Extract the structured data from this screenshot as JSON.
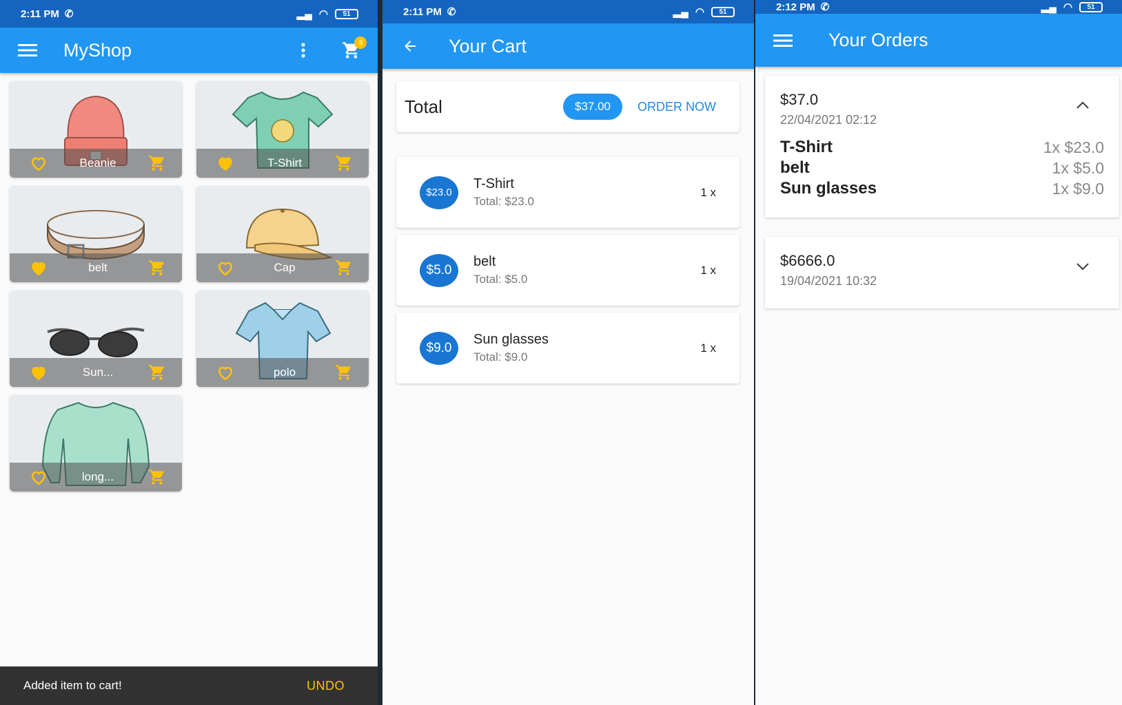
{
  "shop": {
    "status_time": "2:11 PM",
    "battery": "51",
    "title": "MyShop",
    "cart_badge": "3",
    "products": [
      {
        "name": "Beanie",
        "favorite": false,
        "icon": "beanie-image"
      },
      {
        "name": "T-Shirt",
        "favorite": true,
        "icon": "tshirt-image"
      },
      {
        "name": "belt",
        "favorite": true,
        "icon": "belt-image"
      },
      {
        "name": "Cap",
        "favorite": false,
        "icon": "cap-image"
      },
      {
        "name": "Sun...",
        "favorite": true,
        "icon": "sunglasses-image"
      },
      {
        "name": "polo",
        "favorite": false,
        "icon": "polo-image"
      },
      {
        "name": "long...",
        "favorite": false,
        "icon": "longsleeve-image"
      }
    ],
    "snackbar": {
      "message": "Added item to cart!",
      "action": "UNDO"
    }
  },
  "cart": {
    "status_time": "2:11 PM",
    "battery": "51",
    "title": "Your Cart",
    "total_label": "Total",
    "total_value": "$37.00",
    "order_button": "ORDER NOW",
    "items": [
      {
        "price": "$23.0",
        "title": "T-Shirt",
        "subtotal": "Total: $23.0",
        "qty": "1 x"
      },
      {
        "price": "$5.0",
        "title": "belt",
        "subtotal": "Total: $5.0",
        "qty": "1 x"
      },
      {
        "price": "$9.0",
        "title": "Sun glasses",
        "subtotal": "Total: $9.0",
        "qty": "1 x"
      }
    ]
  },
  "orders": {
    "status_time": "2:12 PM",
    "battery": "51",
    "title": "Your Orders",
    "list": [
      {
        "amount": "$37.0",
        "date": "22/04/2021 02:12",
        "expanded": true,
        "items": [
          {
            "name": "T-Shirt",
            "price": "1x $23.0"
          },
          {
            "name": "belt",
            "price": "1x $5.0"
          },
          {
            "name": "Sun glasses",
            "price": "1x $9.0"
          }
        ]
      },
      {
        "amount": "$6666.0",
        "date": "19/04/2021 10:32",
        "expanded": false
      }
    ]
  },
  "colors": {
    "primary": "#2196f3",
    "status": "#1565c0",
    "accent": "#ffc107",
    "avatar": "#1976d2"
  }
}
